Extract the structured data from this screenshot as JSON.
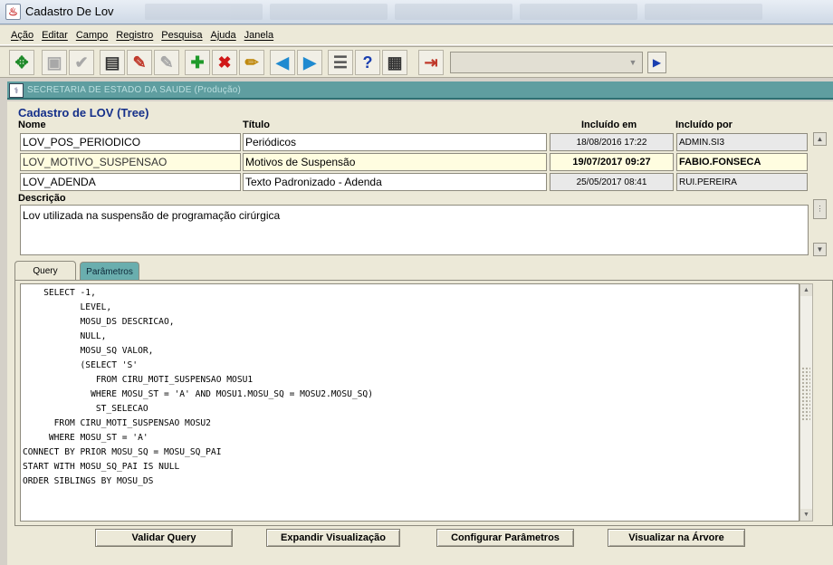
{
  "window": {
    "title": "Cadastro De Lov"
  },
  "menu": [
    "Ação",
    "Editar",
    "Campo",
    "Registro",
    "Pesquisa",
    "Ajuda",
    "Janela"
  ],
  "toolbar": {
    "icons": [
      "move-icon",
      "save-icon",
      "check-icon",
      "form-icon",
      "magic-icon",
      "wand-icon",
      "add-icon",
      "delete-icon",
      "edit-icon",
      "back-arrow-icon",
      "forward-arrow-icon",
      "list-icon",
      "help-icon",
      "print-icon",
      "exit-icon"
    ]
  },
  "secretaria": {
    "text": "SECRETARIA DE ESTADO DA SAUDE (Produção)"
  },
  "form": {
    "title": "Cadastro de LOV (Tree)",
    "headers": {
      "nome": "Nome",
      "titulo": "Título",
      "incluido_em": "Incluído em",
      "incluido_por": "Incluído por"
    },
    "rows": [
      {
        "nome": "LOV_POS_PERIODICO",
        "titulo": "Periódicos",
        "incluido_em": "18/08/2016 17:22",
        "incluido_por": "ADMIN.SI3"
      },
      {
        "nome": "LOV_MOTIVO_SUSPENSAO",
        "titulo": "Motivos de Suspensão",
        "incluido_em": "19/07/2017 09:27",
        "incluido_por": "FABIO.FONSECA"
      },
      {
        "nome": "LOV_ADENDA",
        "titulo": "Texto Padronizado - Adenda",
        "incluido_em": "25/05/2017 08:41",
        "incluido_por": "RUI.PEREIRA"
      }
    ],
    "descricao_label": "Descrição",
    "descricao": "Lov utilizada na suspensão de programação cirúrgica"
  },
  "tabs": {
    "query": "Query",
    "parametros": "Parâmetros"
  },
  "query": "    SELECT -1,\n           LEVEL,\n           MOSU_DS DESCRICAO,\n           NULL,\n           MOSU_SQ VALOR,\n           (SELECT 'S'\n              FROM CIRU_MOTI_SUSPENSAO MOSU1\n             WHERE MOSU_ST = 'A' AND MOSU1.MOSU_SQ = MOSU2.MOSU_SQ)\n              ST_SELECAO\n      FROM CIRU_MOTI_SUSPENSAO MOSU2\n     WHERE MOSU_ST = 'A'\nCONNECT BY PRIOR MOSU_SQ = MOSU_SQ_PAI\nSTART WITH MOSU_SQ_PAI IS NULL\nORDER SIBLINGS BY MOSU_DS",
  "buttons": {
    "validar": "Validar Query",
    "expandir": "Expandir Visualização",
    "configurar": "Configurar Parâmetros",
    "visualizar": "Visualizar na Árvore"
  }
}
